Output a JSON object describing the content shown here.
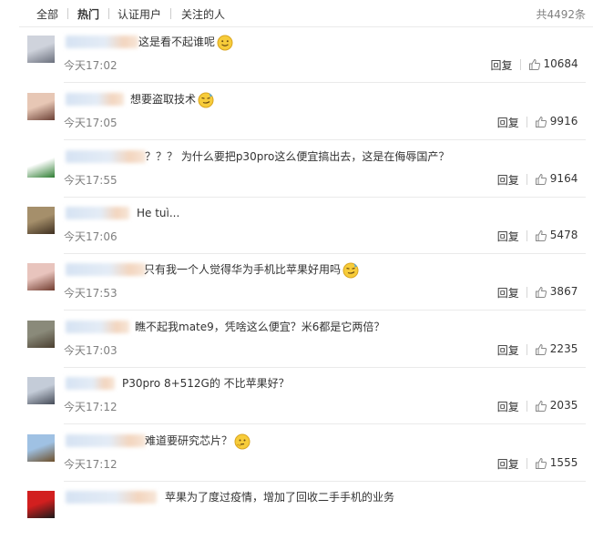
{
  "tabs": [
    "全部",
    "热门",
    "认证用户",
    "关注的人"
  ],
  "active_tab": "热门",
  "total_count": "共4492条",
  "reply_label": "回复",
  "comments": [
    {
      "text": "这是看不起谁呢",
      "emoji": "smile",
      "time": "今天17:02",
      "likes": "10684"
    },
    {
      "text": "想要盗取技术",
      "emoji": "smirk",
      "time": "今天17:05",
      "likes": "9916"
    },
    {
      "text": "？？？ 为什么要把p30pro这么便宜搞出去，这是在侮辱国产？",
      "emoji": "",
      "time": "今天17:55",
      "likes": "9164"
    },
    {
      "text": "He tuì...",
      "emoji": "",
      "time": "今天17:06",
      "likes": "5478"
    },
    {
      "text": "只有我一个人觉得华为手机比苹果好用吗",
      "emoji": "smirk",
      "time": "今天17:53",
      "likes": "3867"
    },
    {
      "text": "瞧不起我mate9，凭啥这么便宜？米6都是它两倍？",
      "emoji": "",
      "time": "今天17:03",
      "likes": "2235"
    },
    {
      "text": "P30pro 8+512G的 不比苹果好？",
      "emoji": "",
      "time": "今天17:12",
      "likes": "2035"
    },
    {
      "text": "难道要研究芯片？",
      "emoji": "think",
      "time": "今天17:12",
      "likes": "1555"
    },
    {
      "text": "苹果为了度过疫情，增加了回收二手手机的业务",
      "emoji": "",
      "time": "",
      "likes": ""
    }
  ]
}
